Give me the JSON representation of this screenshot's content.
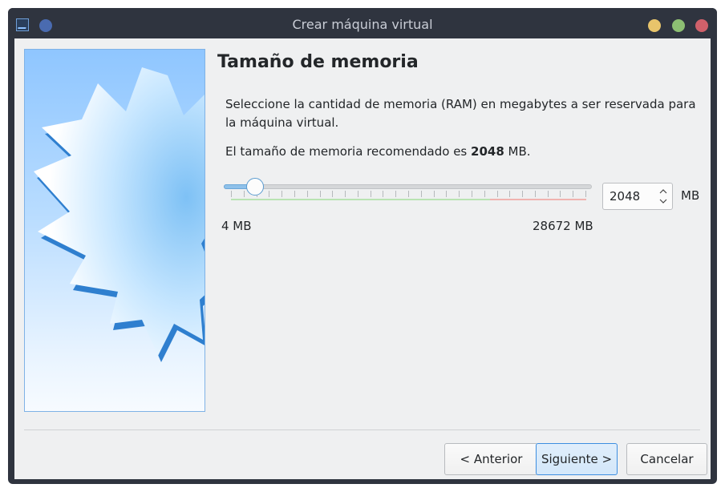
{
  "window": {
    "title": "Crear máquina virtual"
  },
  "page": {
    "heading": "Tamaño de memoria",
    "description": "Seleccione la cantidad de memoria (RAM) en megabytes a ser reservada para la máquina virtual.",
    "recommended_prefix": "El tamaño de memoria recomendado es ",
    "recommended_value": "2048",
    "recommended_suffix": " MB."
  },
  "memory": {
    "slider_value_mb": 2048,
    "min_label": "4 MB",
    "max_label": "28672 MB",
    "spin_value": "2048",
    "unit": "MB"
  },
  "buttons": {
    "back": "< Anterior",
    "next": "Siguiente >",
    "cancel": "Cancelar"
  },
  "colors": {
    "accent": "#3d8ee0",
    "titlebar": "#2f343f",
    "safe_zone": "#b9e3b2",
    "danger_zone": "#f0b3b0"
  },
  "icons": {
    "app": "virtualbox-icon",
    "pin": "pin-icon",
    "spin_up": "chevron-up-icon",
    "spin_down": "chevron-down-icon"
  }
}
